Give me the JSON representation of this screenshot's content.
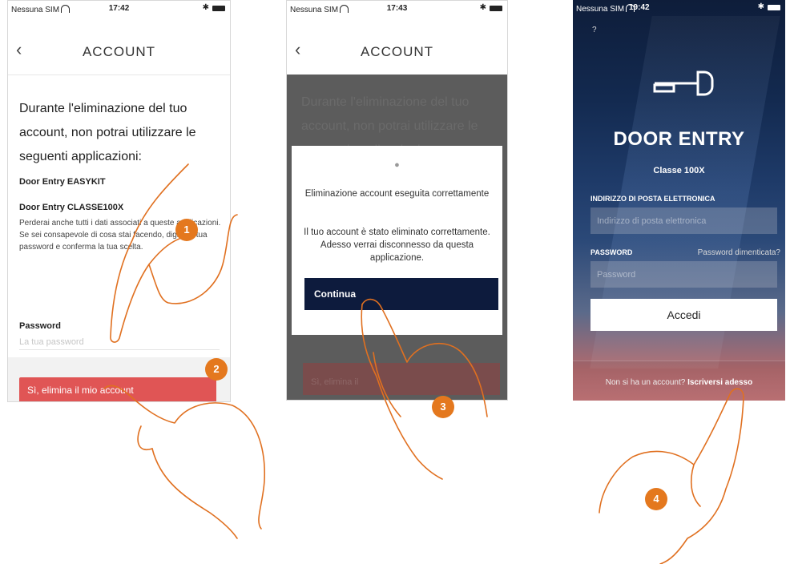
{
  "screens": [
    {
      "status": {
        "carrier": "Nessuna SIM",
        "time": "17:42"
      },
      "nav": {
        "title": "ACCOUNT"
      },
      "heading": "Durante l'eliminazione del tuo account, non potrai utilizzare le seguenti applicazioni:",
      "apps": [
        "Door Entry EASYKIT",
        "Door Entry CLASSE100X"
      ],
      "info_line1": "Perderai anche tutti i dati associati a queste applicazioni.",
      "info_line2": "Se sei consapevole di cosa stai facendo, digita la tua password e conferma la tua scelta.",
      "password_label": "Password",
      "password_placeholder": "La tua password",
      "delete_button": "Sì, elimina il mio account"
    },
    {
      "status": {
        "carrier": "Nessuna SIM",
        "time": "17:43"
      },
      "nav": {
        "title": "ACCOUNT"
      },
      "dim_heading": "Durante l'eliminazione del tuo account, non potrai utilizzare le seguenti applicazioni:",
      "dim_button": "Sì, elimina il",
      "dialog": {
        "title": "Eliminazione account eseguita correttamente",
        "body": "Il tuo account è stato eliminato correttamente. Adesso verrai disconnesso da questa applicazione.",
        "continue_button": "Continua"
      }
    },
    {
      "status": {
        "carrier": "Nessuna SIM",
        "time": "19:42"
      },
      "help": "?",
      "brand": "DOOR ENTRY",
      "subtitle": "Classe 100X",
      "email_label": "INDIRIZZO DI POSTA ELETTRONICA",
      "email_placeholder": "Indirizzo di posta elettronica",
      "password_label": "PASSWORD",
      "forgot_link": "Password dimenticata?",
      "password_placeholder": "Password",
      "login_button": "Accedi",
      "signup_prompt": "Non si ha un account?",
      "signup_link": "Iscriversi adesso"
    }
  ],
  "steps": [
    "1",
    "2",
    "3",
    "4"
  ],
  "colors": {
    "badge": "#e4781e",
    "hand_outline": "#e07020",
    "delete_red": "#e05555",
    "continue_navy": "#0d1b3d"
  }
}
